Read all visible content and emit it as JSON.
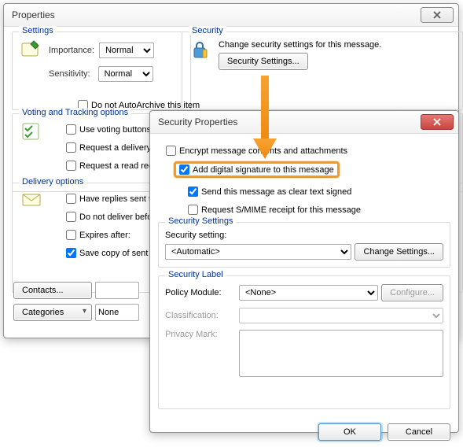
{
  "winA": {
    "title": "Properties",
    "groups": {
      "settings": {
        "legend": "Settings",
        "importance_label": "Importance:",
        "importance_value": "Normal",
        "sensitivity_label": "Sensitivity:",
        "sensitivity_value": "Normal",
        "autoarchive_label": "Do not AutoArchive this item"
      },
      "security": {
        "legend": "Security",
        "desc": "Change security settings for this message.",
        "button": "Security Settings..."
      },
      "voting": {
        "legend": "Voting and Tracking options",
        "use_voting": "Use voting buttons:",
        "req_delivery": "Request a delivery receipt",
        "req_read": "Request a read receipt"
      },
      "delivery": {
        "legend": "Delivery options",
        "have_replies": "Have replies sent to:",
        "no_deliver_before": "Do not deliver before:",
        "expires_after": "Expires after:",
        "save_copy": "Save copy of sent message"
      }
    },
    "contacts_btn": "Contacts...",
    "categories_btn": "Categories",
    "categories_value": "None"
  },
  "winB": {
    "title": "Security Properties",
    "encrypt": "Encrypt message contents and attachments",
    "sign": "Add digital signature to this message",
    "cleartext": "Send this message as clear text signed",
    "smime": "Request S/MIME receipt for this message",
    "secSettings": {
      "legend": "Security Settings",
      "label": "Security setting:",
      "value": "<Automatic>",
      "change_btn": "Change Settings..."
    },
    "secLabel": {
      "legend": "Security Label",
      "policy_label": "Policy Module:",
      "policy_value": "<None>",
      "configure_btn": "Configure...",
      "classification_label": "Classification:",
      "privacy_label": "Privacy Mark:"
    },
    "ok": "OK",
    "cancel": "Cancel"
  }
}
